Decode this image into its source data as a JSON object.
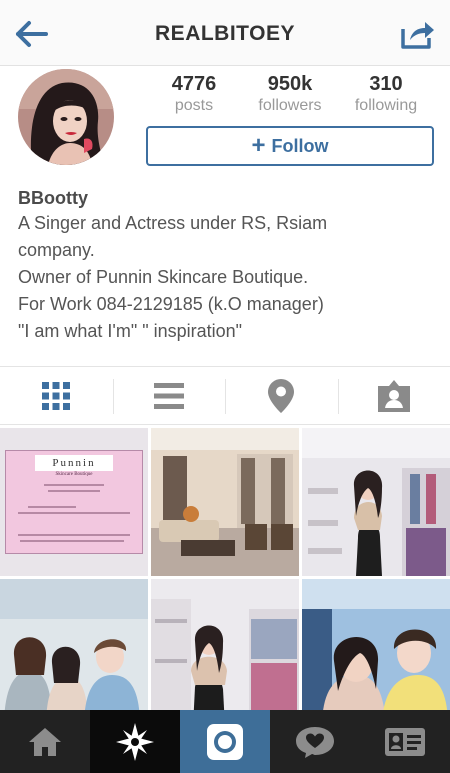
{
  "header": {
    "title": "REALBITOEY",
    "back_icon": "arrow-left-icon",
    "share_icon": "share-icon"
  },
  "profile": {
    "stats": [
      {
        "value": "4776",
        "label": "posts"
      },
      {
        "value": "950k",
        "label": "followers"
      },
      {
        "value": "310",
        "label": "following"
      }
    ],
    "follow_label": "Follow",
    "name": "BBootty",
    "bio_lines": [
      "A Singer and Actress under RS, Rsiam",
      "company.",
      "Owner of Punnin Skincare Boutique.",
      "For Work 084-2129185 (k.O manager)",
      "\"I am what I'm\" \" inspiration\""
    ]
  },
  "view_tabs": [
    {
      "icon": "grid-icon",
      "active": true
    },
    {
      "icon": "list-icon",
      "active": false
    },
    {
      "icon": "location-pin-icon",
      "active": false
    },
    {
      "icon": "tagged-user-icon",
      "active": false
    }
  ],
  "flyer": {
    "logo": "Punnin",
    "logo_sub": "Skincare Boutique"
  },
  "bottom_nav": [
    {
      "icon": "home-icon"
    },
    {
      "icon": "explore-star-icon"
    },
    {
      "icon": "camera-icon"
    },
    {
      "icon": "activity-heart-icon"
    },
    {
      "icon": "profile-card-icon"
    }
  ],
  "colors": {
    "accent": "#3d6fa0",
    "nav_bg": "#222222",
    "nav_active": "#3e6e98",
    "muted": "#999999"
  }
}
